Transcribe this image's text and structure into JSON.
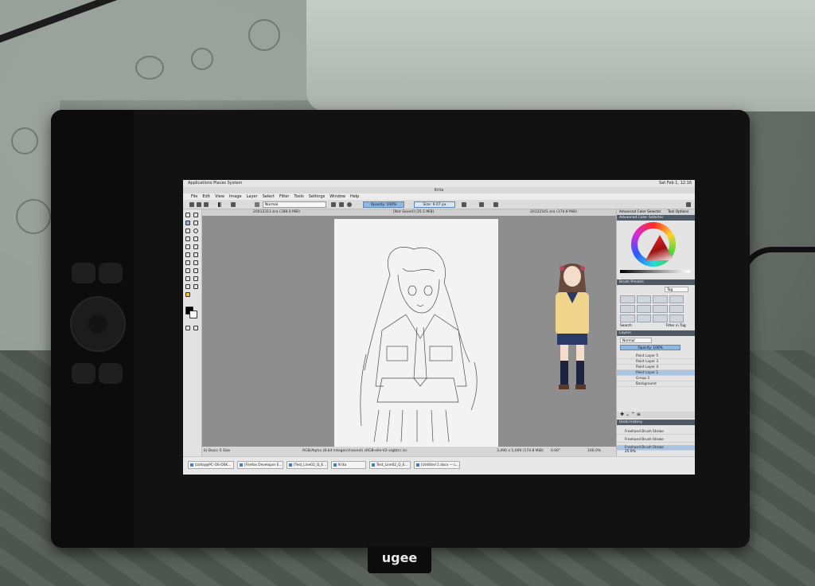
{
  "screen": {
    "topbar": {
      "menu": "Applications  Places  System",
      "clock": "Sat Feb 1, 12:16"
    },
    "window_title": "Krita",
    "menubar": [
      "File",
      "Edit",
      "View",
      "Image",
      "Layer",
      "Select",
      "Filter",
      "Tools",
      "Settings",
      "Window",
      "Help"
    ],
    "toolbar": {
      "blend_mode": "Normal",
      "opacity": "Opacity: 100%",
      "size": "Size: 9.07 px"
    },
    "doc_tabs": [
      "20012311.kra (188.0 MiB)",
      "[Not Saved] (35.5 MiB)",
      "20122541.kra (174.8 MiB)"
    ],
    "status": {
      "left": "b) Basic-5 Size",
      "middle": "RGB/Alpha (8-bit integer/channel)  sRGB-elle-V2-srgbtrc.icc",
      "coords": "3,490 x 5,009 (174.8 MiB)",
      "angle": "0.00°",
      "zoom": "100.0%",
      "zoom2": "25.0%"
    },
    "dock": {
      "color_tabs": [
        "Advanced Color Selector",
        "Tool Options"
      ],
      "color_title": "Advanced Color Selector",
      "presets_title": "Brush Presets",
      "presets_tag": "Tag",
      "search_label": "Search",
      "filter_label": "Filter in Tag",
      "layers_title": "Layers",
      "layer_blend": "Normal",
      "layer_opacity": "Opacity: 100%",
      "layers": [
        "Paint Layer 5",
        "Paint Layer 3",
        "Paint Layer 4",
        "Paint Layer 1",
        "Group 2",
        "Background"
      ],
      "history_title": "Undo History",
      "history": [
        "Freehand Brush Stroke",
        "Freehand Brush Stroke",
        "Freehand Brush Stroke"
      ]
    },
    "taskbar": [
      "[zahaj@PC-OS-DSK...",
      "[Firefox Developer E...",
      "[Test_Line02_Q_E...",
      "Krita",
      "Test_Line02_Q_E...",
      "[Untitled 1.docx — L..."
    ]
  },
  "tablet": {
    "brand": "ugee"
  },
  "colors": {
    "accent": "#8fb7e0",
    "panel_title": "#4f5a66",
    "layer_active": "#a9c4e2"
  }
}
